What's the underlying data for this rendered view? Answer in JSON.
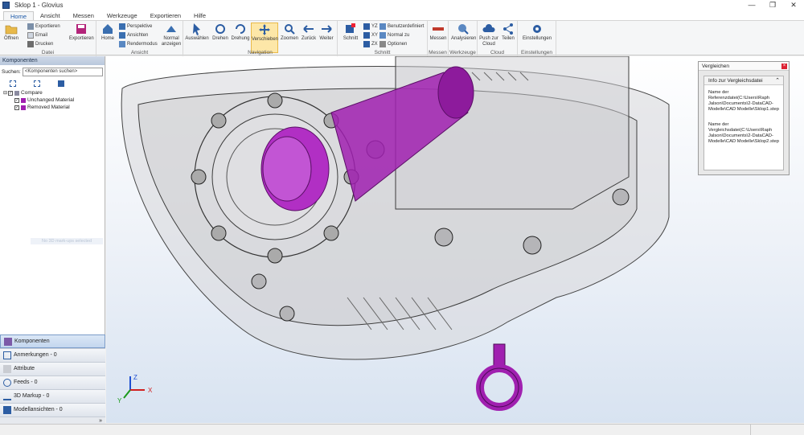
{
  "window": {
    "title": "Sklop 1 - Glovius",
    "minimize": "—",
    "maximize": "❐",
    "close": "✕"
  },
  "ribbon": {
    "tabs": [
      {
        "label": "Home"
      },
      {
        "label": "Ansicht"
      },
      {
        "label": "Messen"
      },
      {
        "label": "Werkzeuge"
      },
      {
        "label": "Exportieren"
      },
      {
        "label": "Hilfe"
      }
    ],
    "active_tab": "Home",
    "groups": {
      "datei": {
        "label": "Datei",
        "open": "Öffnen",
        "export_list": [
          "Exportieren",
          "Email",
          "Drucken"
        ],
        "export_btn": "Exportieren"
      },
      "ansicht": {
        "label": "Ansicht",
        "home": "Home",
        "perspective": "Perspektive",
        "views": "Ansichten",
        "rendermodes": "Rendermodus",
        "normal": "Normal anzeigen"
      },
      "navigation": {
        "label": "Navigation",
        "select": "Auswählen",
        "rotate": "Drehen",
        "spin": "Drehung",
        "move": "Verschieben",
        "zoom": "Zoomen",
        "back": "Zurück",
        "forward": "Weiter"
      },
      "schnitt": {
        "label": "Schnitt",
        "section": "Schnitt",
        "yz": "YZ",
        "xy": "XY",
        "zx": "ZX",
        "custom": "Benutzerdefiniert",
        "normal_to": "Normal zu",
        "options": "Optionen"
      },
      "messen": {
        "label": "Messen",
        "measure": "Messen"
      },
      "werkzeuge": {
        "label": "Werkzeuge",
        "analyze": "Analysieren"
      },
      "cloud": {
        "label": "Cloud",
        "push": "Push zur Cloud",
        "share": "Teilen"
      },
      "einstellungen": {
        "label": "Einstellungen",
        "settings": "Einstellungen"
      }
    }
  },
  "left_panel": {
    "header": "Komponenten",
    "search_label": "Suchen:",
    "search_value": "<Komponenten suchen>",
    "tree": {
      "root": "Compare",
      "children": [
        "Unchanged Material",
        "Removed Material"
      ]
    },
    "ghost_text": "No 3D mark-ups selected",
    "nav_items": [
      {
        "label": "Komponenten"
      },
      {
        "label": "Anmerkungen - 0"
      },
      {
        "label": "Attribute"
      },
      {
        "label": "Feeds - 0"
      },
      {
        "label": "3D Markup - 0"
      },
      {
        "label": "Modellansichten - 0"
      }
    ],
    "nav_expand": "»"
  },
  "compare_panel": {
    "title": "Vergleichen",
    "close": "×",
    "section": "Info zur Vergleichsdatei",
    "collapse": "⌃",
    "ref_text": "Name der Referenzdatei(C:\\Users\\Raph Jalson\\Documents\\2-DataCAD-Modelle\\CAD Modelle\\Sklop1.step",
    "cmp_text": "Name der Vergleichsdatei(C:\\Users\\Raph Jalson\\Documents\\2-DataCAD-Modelle\\CAD Modelle\\Sklop2.step"
  },
  "axes": {
    "x": "X",
    "y": "Y",
    "z": "Z"
  },
  "colors": {
    "accent": "#1e5aa8",
    "highlight_part": "#a020b0",
    "active_button": "#fde7a8"
  }
}
